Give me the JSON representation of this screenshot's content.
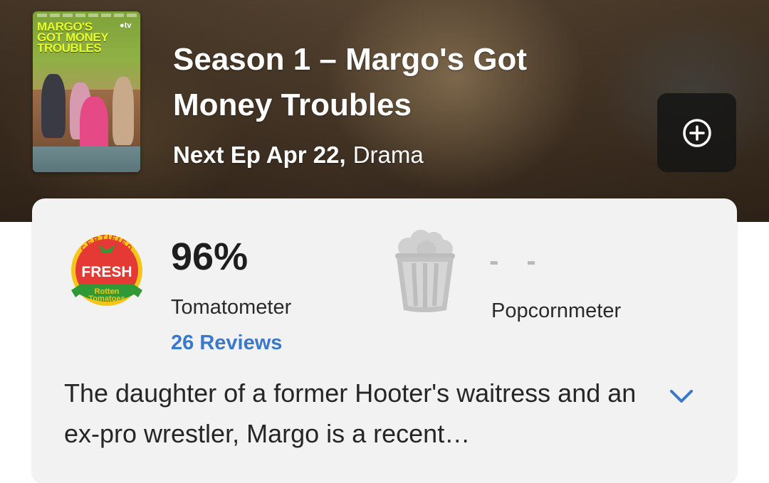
{
  "hero": {
    "poster": {
      "title_line1": "MARGO'S",
      "title_line2": "GOT MONEY",
      "title_line3": "TROUBLES",
      "network": "tv"
    },
    "title": "Season 1 – Margo's Got Money Troubles",
    "next_episode": "Next Ep Apr 22,",
    "genre": "Drama",
    "add_icon": "plus-circle-icon"
  },
  "scores": {
    "tomatometer": {
      "badge": {
        "top_text": "CERTIFIED",
        "main_text": "FRESH",
        "brand_line1": "Rotten",
        "brand_line2": "Tomatoes"
      },
      "value": "96%",
      "label": "Tomatometer",
      "reviews_link": "26 Reviews"
    },
    "popcornmeter": {
      "icon": "popcorn-bucket-icon",
      "value": "- -",
      "label": "Popcornmeter"
    }
  },
  "synopsis": {
    "text": "The daughter of a former Hooter's waitress and an ex-pro wrestler, Margo is a recent…",
    "expand_icon": "chevron-down-icon"
  },
  "colors": {
    "link_blue": "#3a78c9",
    "card_background": "#f2f2f2",
    "fresh_red": "#e53935",
    "certified_yellow": "#f5c518",
    "rt_green": "#2f9a35"
  }
}
